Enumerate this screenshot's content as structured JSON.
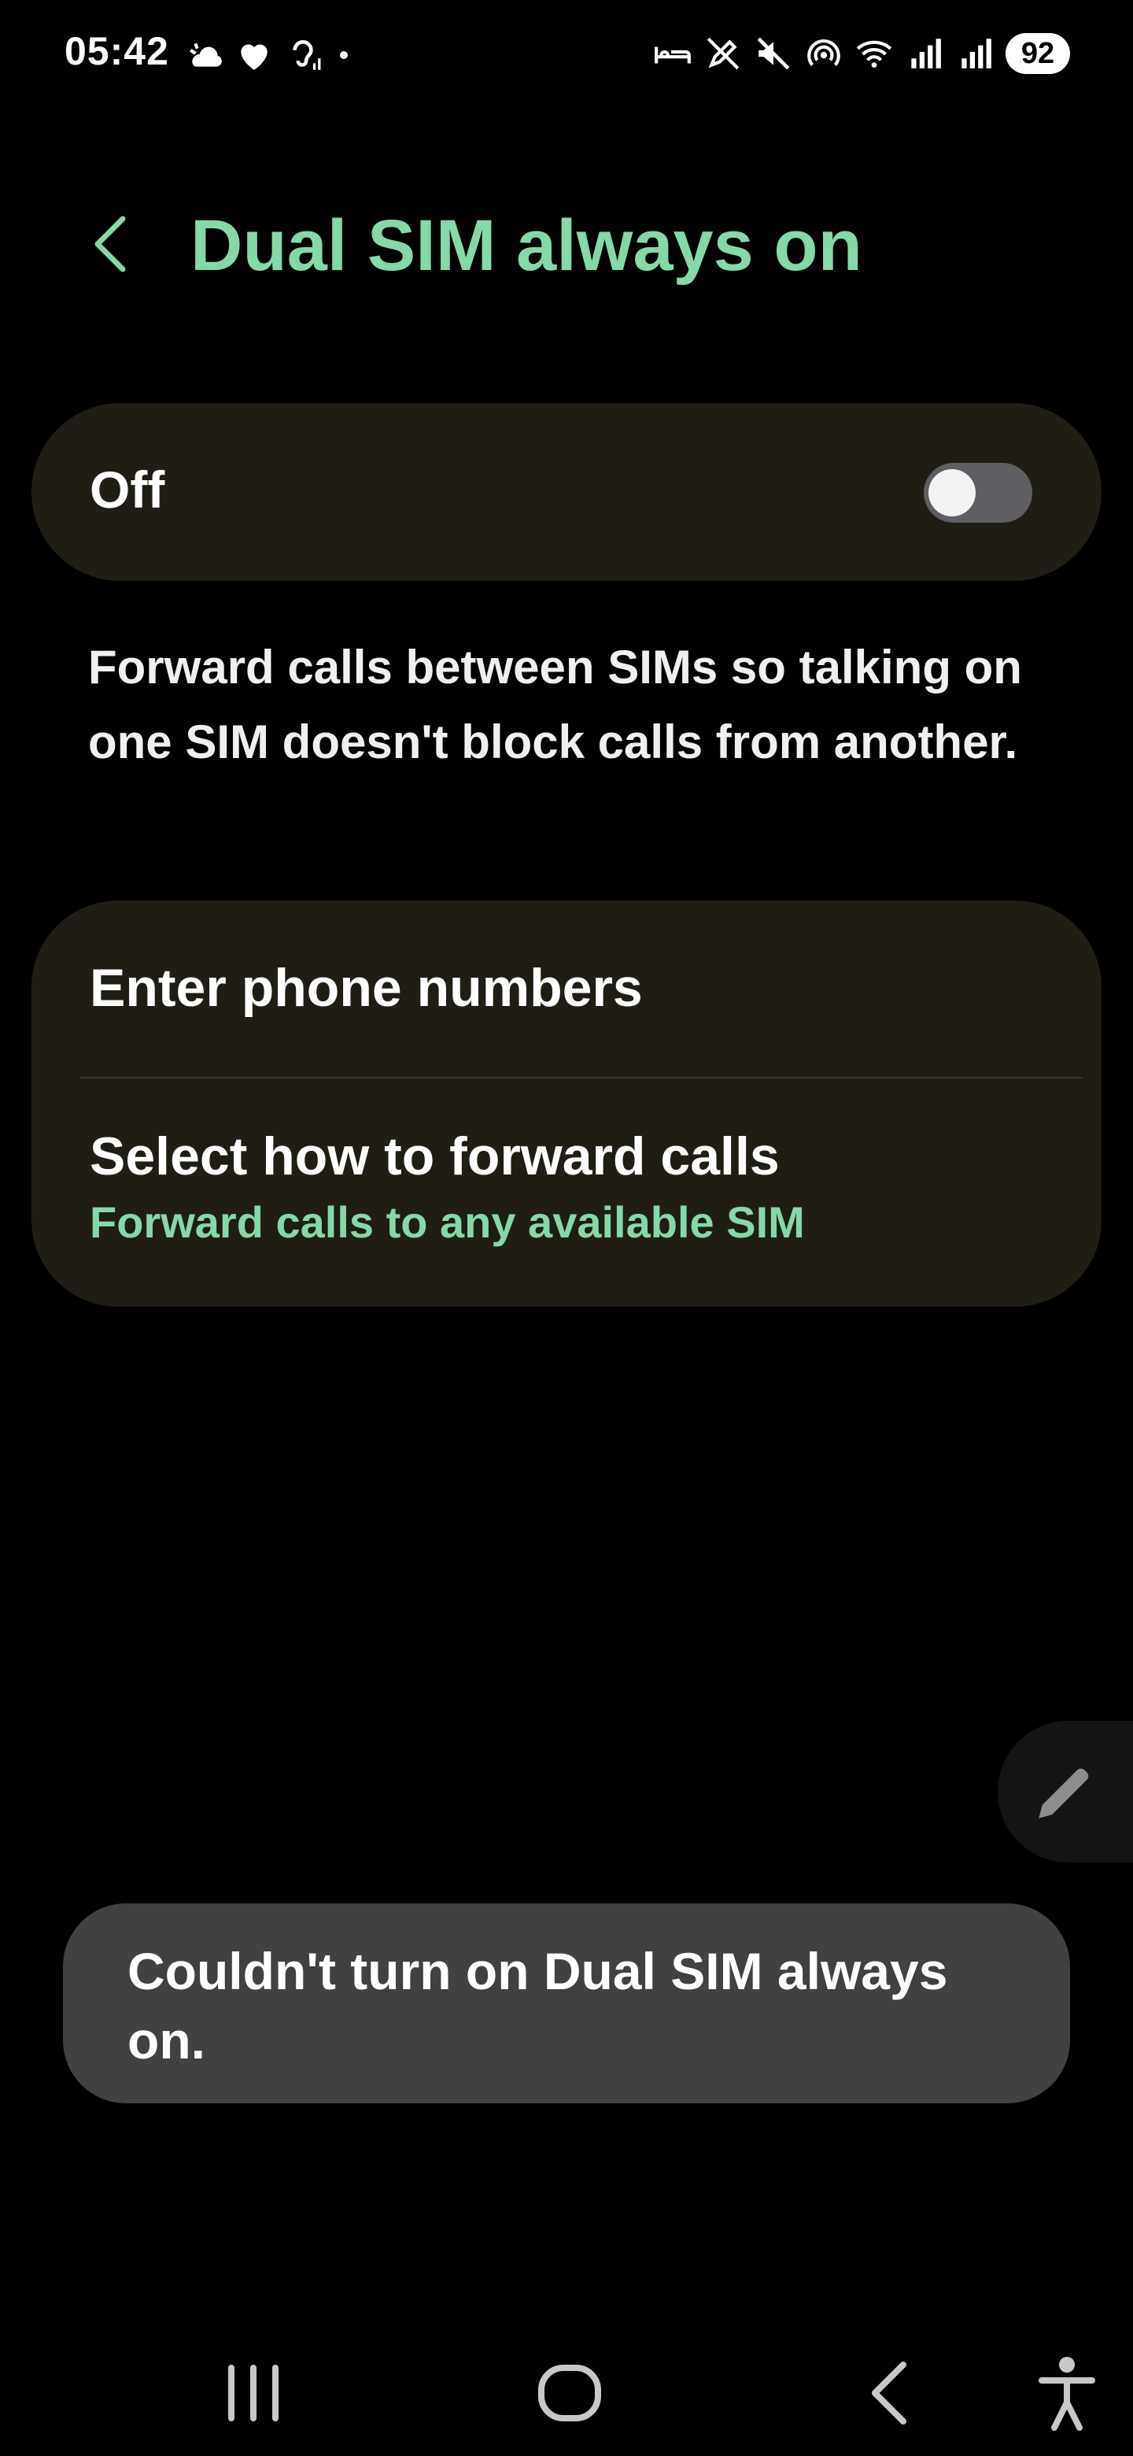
{
  "status_bar": {
    "time": "05:42",
    "left_icons": [
      "weather-icon",
      "heart-icon",
      "hearing-icon",
      "dot-icon"
    ],
    "right_icons": [
      "sleep-mode-icon",
      "pen-off-icon",
      "mute-icon",
      "hotspot-icon",
      "wifi-icon",
      "signal-sim1-icon",
      "signal-sim2-icon"
    ],
    "battery": "92"
  },
  "header": {
    "title": "Dual SIM always on"
  },
  "master_toggle": {
    "label": "Off",
    "state": false
  },
  "description": "Forward calls between SIMs so talking on one SIM doesn't block calls from another.",
  "options": [
    {
      "title": "Enter phone numbers"
    },
    {
      "title": "Select how to forward calls",
      "subtitle": "Forward calls to any available SIM"
    }
  ],
  "toast": {
    "message": "Couldn't turn on Dual SIM always on."
  },
  "colors": {
    "accent": "#85d8a8",
    "card": "#201d15",
    "toast": "#414144",
    "background": "#000000"
  }
}
